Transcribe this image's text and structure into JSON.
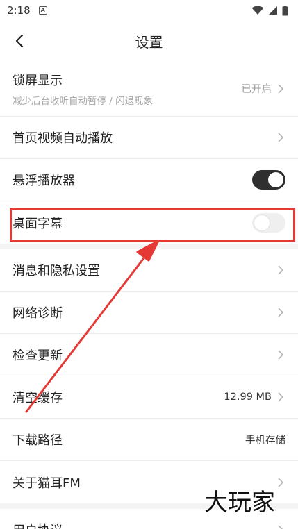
{
  "status_bar": {
    "time": "2:18",
    "notification_icon_text": "A"
  },
  "nav": {
    "title": "设置"
  },
  "settings": {
    "lock_screen": {
      "label": "锁屏显示",
      "sub": "减少后台收听自动暂停 / 闪退现象",
      "value": "已开启"
    },
    "homepage_autoplay": {
      "label": "首页视频自动播放"
    },
    "floating_player": {
      "label": "悬浮播放器",
      "enabled": true
    },
    "desktop_subtitle": {
      "label": "桌面字幕",
      "enabled": false
    },
    "privacy": {
      "label": "消息和隐私设置"
    },
    "network": {
      "label": "网络诊断"
    },
    "update": {
      "label": "检查更新"
    },
    "cache": {
      "label": "清空缓存",
      "value": "12.99 MB"
    },
    "download_path": {
      "label": "下载路径",
      "value": "手机存储"
    },
    "about": {
      "label": "关于猫耳FM"
    },
    "agreement": {
      "label": "用户协议"
    }
  },
  "watermark": {
    "text": "大玩家"
  },
  "colors": {
    "highlight": "#e53935",
    "toggle_on": "#2f2f2f",
    "toggle_off": "#efefef"
  }
}
